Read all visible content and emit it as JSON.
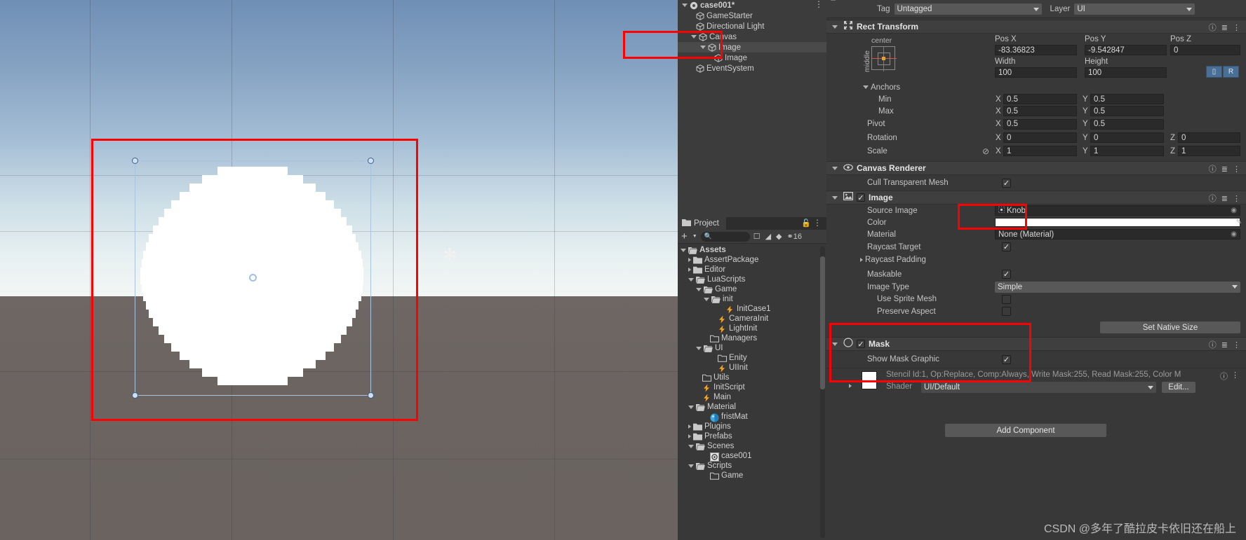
{
  "app": "Unity Editor",
  "scene_view": {
    "selection_outline_label": "selection-rect",
    "gizmo_icon": "✻"
  },
  "hierarchy": {
    "scene_name": "case001*",
    "items": [
      {
        "label": "case001*",
        "indent": 0,
        "type": "scene",
        "expanded": true,
        "selected": false
      },
      {
        "label": "GameStarter",
        "indent": 1,
        "type": "gameobject",
        "expanded": false,
        "selected": false
      },
      {
        "label": "Directional Light",
        "indent": 1,
        "type": "gameobject",
        "expanded": false,
        "selected": false
      },
      {
        "label": "Canvas",
        "indent": 1,
        "type": "gameobject",
        "expanded": true,
        "selected": false
      },
      {
        "label": "Image",
        "indent": 2,
        "type": "gameobject",
        "expanded": true,
        "selected": true
      },
      {
        "label": "Image",
        "indent": 3,
        "type": "gameobject",
        "expanded": false,
        "selected": false
      },
      {
        "label": "EventSystem",
        "indent": 1,
        "type": "gameobject",
        "expanded": false,
        "selected": false
      }
    ]
  },
  "project": {
    "tab_label": "Project",
    "search_placeholder": "",
    "toolbar": {
      "add_label": "+",
      "hidden_count": "16"
    },
    "items": [
      {
        "label": "Assets",
        "indent": 0,
        "type": "folder-open",
        "arrow": "down",
        "bold": true
      },
      {
        "label": "AssertPackage",
        "indent": 1,
        "type": "folder",
        "arrow": "right"
      },
      {
        "label": "Editor",
        "indent": 1,
        "type": "folder",
        "arrow": "right"
      },
      {
        "label": "LuaScripts",
        "indent": 1,
        "type": "folder-open",
        "arrow": "down"
      },
      {
        "label": "Game",
        "indent": 2,
        "type": "folder-open",
        "arrow": "down"
      },
      {
        "label": "init",
        "indent": 3,
        "type": "folder-open",
        "arrow": "down"
      },
      {
        "label": "InitCase1",
        "indent": 5,
        "type": "lua",
        "arrow": "none"
      },
      {
        "label": "CameraInit",
        "indent": 4,
        "type": "lua",
        "arrow": "none"
      },
      {
        "label": "LightInit",
        "indent": 4,
        "type": "lua",
        "arrow": "none"
      },
      {
        "label": "Managers",
        "indent": 3,
        "type": "folder-empty",
        "arrow": "none"
      },
      {
        "label": "UI",
        "indent": 2,
        "type": "folder-open",
        "arrow": "down"
      },
      {
        "label": "Enity",
        "indent": 4,
        "type": "folder-empty",
        "arrow": "none"
      },
      {
        "label": "UIInit",
        "indent": 4,
        "type": "lua",
        "arrow": "none"
      },
      {
        "label": "Utils",
        "indent": 2,
        "type": "folder-empty",
        "arrow": "none"
      },
      {
        "label": "InitScript",
        "indent": 2,
        "type": "lua",
        "arrow": "none"
      },
      {
        "label": "Main",
        "indent": 2,
        "type": "lua",
        "arrow": "none"
      },
      {
        "label": "Material",
        "indent": 1,
        "type": "folder-open",
        "arrow": "down"
      },
      {
        "label": "fristMat",
        "indent": 3,
        "type": "material",
        "arrow": "none"
      },
      {
        "label": "Plugins",
        "indent": 1,
        "type": "folder",
        "arrow": "right"
      },
      {
        "label": "Prefabs",
        "indent": 1,
        "type": "folder",
        "arrow": "right"
      },
      {
        "label": "Scenes",
        "indent": 1,
        "type": "folder-open",
        "arrow": "down"
      },
      {
        "label": "case001",
        "indent": 3,
        "type": "scene",
        "arrow": "none"
      },
      {
        "label": "Scripts",
        "indent": 1,
        "type": "folder-open",
        "arrow": "down"
      },
      {
        "label": "Game",
        "indent": 3,
        "type": "folder-empty",
        "arrow": "none"
      }
    ]
  },
  "inspector": {
    "tag": {
      "label": "Tag",
      "value": "Untagged"
    },
    "layer": {
      "label": "Layer",
      "value": "UI"
    },
    "rect_transform": {
      "title": "Rect Transform",
      "anchor_preset_h": "center",
      "anchor_preset_v": "middle",
      "pos_x_label": "Pos X",
      "pos_x": "-83.36823",
      "pos_y_label": "Pos Y",
      "pos_y": "-9.542847",
      "pos_z_label": "Pos Z",
      "pos_z": "0",
      "width_label": "Width",
      "width": "100",
      "height_label": "Height",
      "height": "100",
      "blue_btn_r": "R",
      "anchors_label": "Anchors",
      "min_label": "Min",
      "min_x": "0.5",
      "min_y": "0.5",
      "max_label": "Max",
      "max_x": "0.5",
      "max_y": "0.5",
      "pivot_label": "Pivot",
      "pivot_x": "0.5",
      "pivot_y": "0.5",
      "rotation_label": "Rotation",
      "rot_x": "0",
      "rot_y": "0",
      "rot_z": "0",
      "scale_label": "Scale",
      "scale_x": "1",
      "scale_y": "1",
      "scale_z": "1",
      "axis_x": "X",
      "axis_y": "Y",
      "axis_z": "Z"
    },
    "canvas_renderer": {
      "title": "Canvas Renderer",
      "cull_label": "Cull Transparent Mesh",
      "cull_checked": true
    },
    "image": {
      "title": "Image",
      "enabled": true,
      "source_image_label": "Source Image",
      "source_image_value": "Knob",
      "color_label": "Color",
      "color_value": "#FFFFFF",
      "material_label": "Material",
      "material_value": "None (Material)",
      "raycast_target_label": "Raycast Target",
      "raycast_target_checked": true,
      "raycast_padding_label": "Raycast Padding",
      "maskable_label": "Maskable",
      "maskable_checked": true,
      "image_type_label": "Image Type",
      "image_type_value": "Simple",
      "use_sprite_mesh_label": "Use Sprite Mesh",
      "use_sprite_mesh_checked": false,
      "preserve_aspect_label": "Preserve Aspect",
      "preserve_aspect_checked": false,
      "set_native_size_label": "Set Native Size"
    },
    "mask": {
      "title": "Mask",
      "enabled": true,
      "show_mask_graphic_label": "Show Mask Graphic",
      "show_mask_graphic_checked": true
    },
    "material_preview": {
      "stencil_info": "Stencil Id:1, Op:Replace, Comp:Always, Write Mask:255, Read Mask:255, Color M",
      "shader_label": "Shader",
      "shader_value": "UI/Default",
      "edit_label": "Edit..."
    },
    "add_component_label": "Add Component"
  },
  "watermark": "CSDN @多年了酷拉皮卡依旧还在船上",
  "colors": {
    "accent_red": "#fe0000",
    "panel_bg": "#383838",
    "header_bg": "#3c3c3c",
    "field_bg": "#2a2a2a",
    "blue_button": "#4a6f96"
  }
}
